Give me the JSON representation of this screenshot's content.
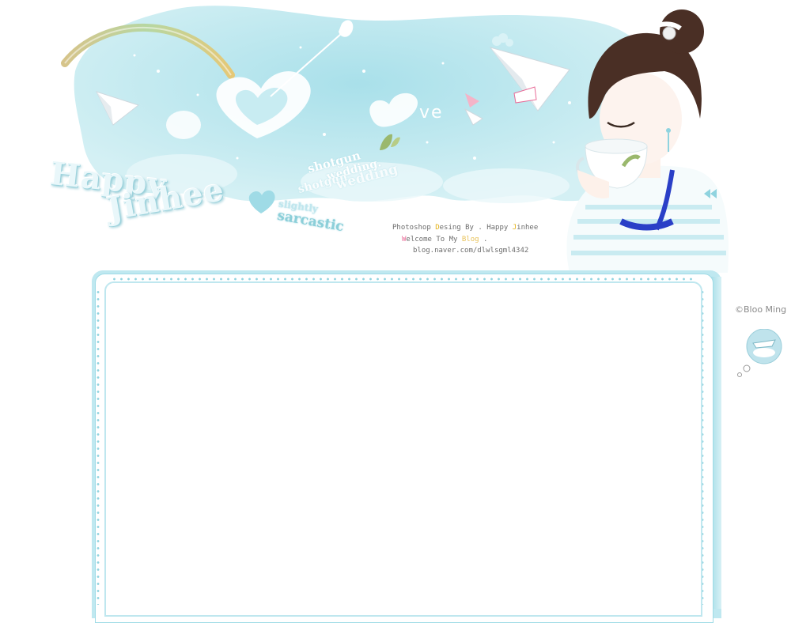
{
  "header": {
    "title_line1": "Happy",
    "title_line2": "Jinhee",
    "deco_words": {
      "shotgun": "shotgun",
      "wedding": "wedding.",
      "shotgun2": "shotgun",
      "wedding2": "wedding",
      "slightly": "slightly",
      "sarcastic": "sarcastic",
      "love_suffix": "ve"
    },
    "credits": {
      "line1_prefix": "Photoshop ",
      "line1_d": "D",
      "line1_mid": "esing By . Happy ",
      "line1_j": "J",
      "line1_end": "inhee",
      "line2_w": "W",
      "line2_mid": "elcome To My ",
      "line2_blog": "Blog",
      "line2_end": " .",
      "line3": "blog.naver.com/dlwlsgml4342"
    },
    "paper_plane_label": "love"
  },
  "widget": {
    "credit": "©Bloo Ming"
  },
  "colors": {
    "sky": "#bfe8ef",
    "frame": "#bfe8f0",
    "dots": "#8fd3df",
    "hair": "#4a2f25"
  }
}
